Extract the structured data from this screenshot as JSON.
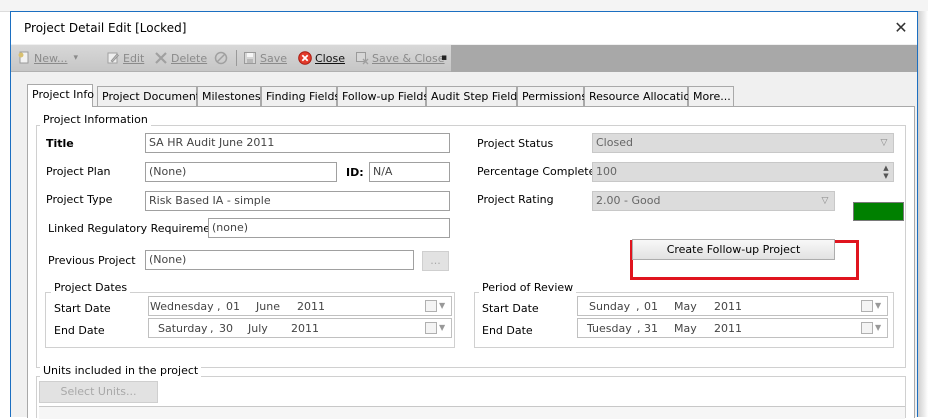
{
  "window": {
    "title": "Project Detail Edit [Locked]",
    "close_glyph": "✕"
  },
  "toolbar": {
    "new_label": "New...",
    "edit_label": "Edit",
    "delete_label": "Delete",
    "save_label": "Save",
    "close_label": "Close",
    "save_close_label": "Save & Close",
    "dropdown_glyph": "▾",
    "more_glyph": "▪"
  },
  "tabs": [
    {
      "label": "Project Info",
      "active": true
    },
    {
      "label": "Project Documents"
    },
    {
      "label": "Milestones"
    },
    {
      "label": "Finding Fields"
    },
    {
      "label": "Follow-up Fields"
    },
    {
      "label": "Audit Step Fields"
    },
    {
      "label": "Permissions"
    },
    {
      "label": "Resource Allocation"
    },
    {
      "label": "More..."
    }
  ],
  "project_info": {
    "legend": "Project Information",
    "title_label": "Title",
    "title_value": "SA HR Audit June 2011",
    "plan_label": "Project Plan",
    "plan_value": "(None)",
    "id_label": "ID:",
    "id_value": "N/A",
    "type_label": "Project Type",
    "type_value": "Risk Based IA - simple",
    "linked_label": "Linked Regulatory Requirement",
    "linked_value": "(none)",
    "previous_label": "Previous Project",
    "previous_value": "(None)",
    "browse_label": "...",
    "status_label": "Project Status",
    "status_value": "Closed",
    "percent_label": "Percentage Complete",
    "percent_value": "100",
    "rating_label": "Project Rating",
    "rating_value": "2.00 - Good",
    "rating_color": "#008000",
    "followup_button": "Create Follow-up Project",
    "highlight_color": "#e0141e"
  },
  "project_dates": {
    "legend": "Project Dates",
    "start_label": "Start Date",
    "start": {
      "weekday": "Wednesday",
      "sep": ",",
      "day": "01",
      "month": "June",
      "year": "2011"
    },
    "end_label": "End Date",
    "end": {
      "weekday": "Saturday",
      "sep": ",",
      "day": "30",
      "month": "July",
      "year": "2011"
    }
  },
  "period_of_review": {
    "legend": "Period of Review",
    "start_label": "Start Date",
    "start": {
      "weekday": "Sunday",
      "sep": ",",
      "day": "01",
      "month": "May",
      "year": "2011"
    },
    "end_label": "End Date",
    "end": {
      "weekday": "Tuesday",
      "sep": ",",
      "day": "31",
      "month": "May",
      "year": "2011"
    }
  },
  "units": {
    "legend": "Units included in the project",
    "select_button": "Select Units..."
  },
  "icons": {
    "new": "new-document-icon",
    "edit": "edit-pencil-icon",
    "delete": "delete-x-icon",
    "disabled": "disabled-circle-icon",
    "save": "save-disk-icon",
    "close": "close-red-circle-icon",
    "save_close": "save-close-icon",
    "calendar": "calendar-icon",
    "combo_arrow": "chevron-down-icon"
  }
}
